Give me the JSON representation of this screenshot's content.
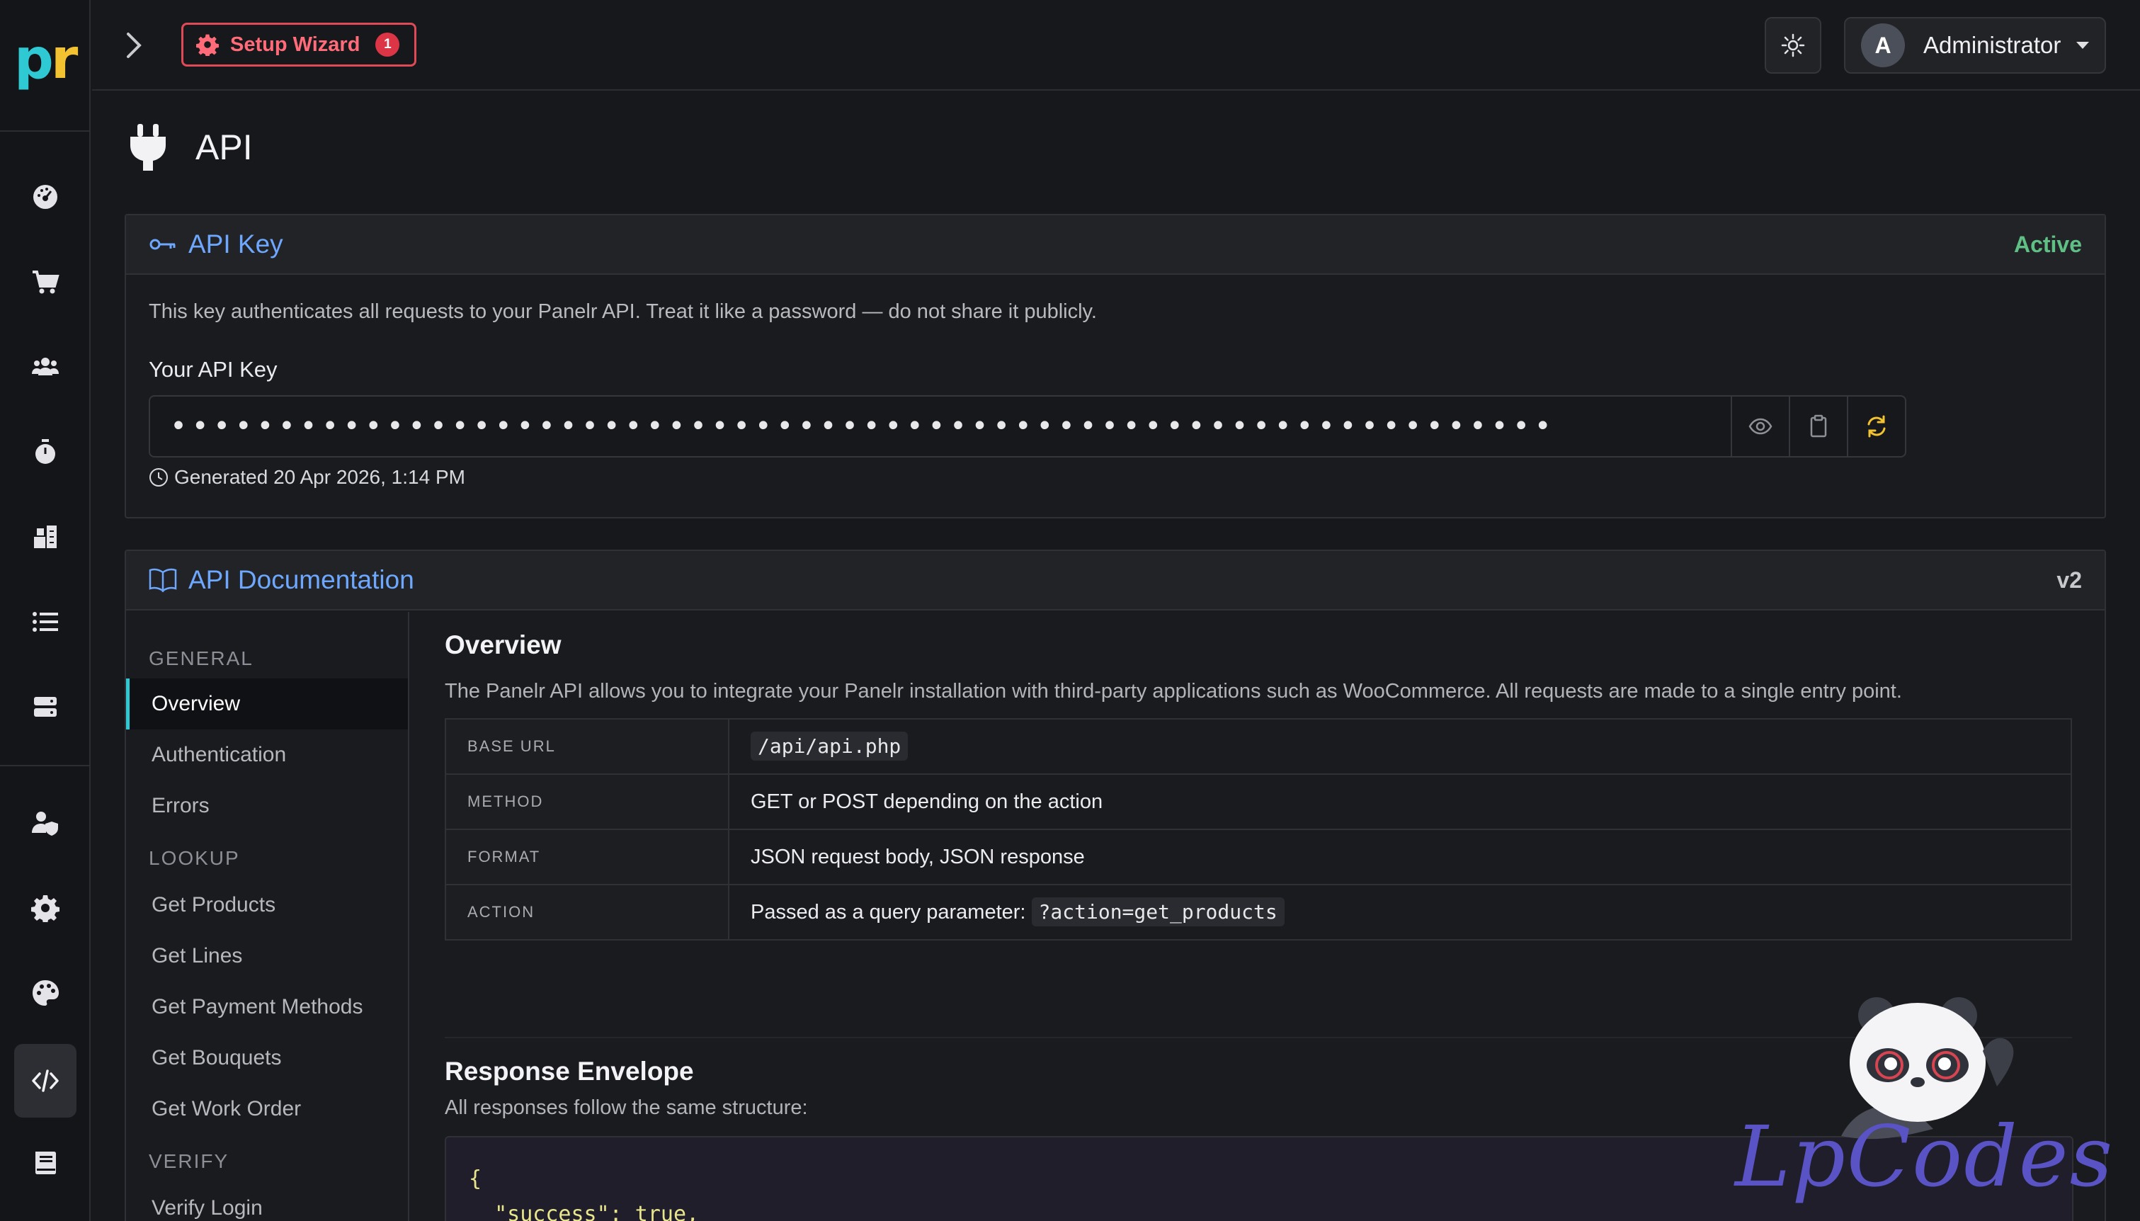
{
  "sidebar": {
    "logo": {
      "p": "p",
      "r": "r"
    },
    "items": [
      {
        "name": "dashboard",
        "icon": "gauge-icon"
      },
      {
        "name": "orders",
        "icon": "cart-icon"
      },
      {
        "name": "customers",
        "icon": "users-icon"
      },
      {
        "name": "timers",
        "icon": "stopwatch-icon"
      },
      {
        "name": "stock",
        "icon": "boxes-icon"
      },
      {
        "name": "lists",
        "icon": "list-icon"
      },
      {
        "name": "servers",
        "icon": "server-icon"
      },
      {
        "name": "user-admin",
        "icon": "user-shield-icon"
      },
      {
        "name": "settings",
        "icon": "gear-icon"
      },
      {
        "name": "theme",
        "icon": "palette-icon"
      },
      {
        "name": "api",
        "icon": "code-icon",
        "active": true
      },
      {
        "name": "docs",
        "icon": "book-icon"
      }
    ]
  },
  "topbar": {
    "setup_wizard_label": "Setup Wizard",
    "setup_wizard_badge": "1",
    "user_initial": "A",
    "user_name": "Administrator"
  },
  "page": {
    "title": "API"
  },
  "api_key": {
    "title": "API Key",
    "status": "Active",
    "description": "This key authenticates all requests to your Panelr API. Treat it like a password — do not share it publicly.",
    "label": "Your API Key",
    "masked_value": "••••••••••••••••••••••••••••••••••••••••••••••••••••••••••••••••",
    "generated": "Generated 20 Apr 2026, 1:14 PM"
  },
  "docs": {
    "title": "API Documentation",
    "version": "v2",
    "nav": {
      "general_label": "GENERAL",
      "general": [
        "Overview",
        "Authentication",
        "Errors"
      ],
      "lookup_label": "LOOKUP",
      "lookup": [
        "Get Products",
        "Get Lines",
        "Get Payment Methods",
        "Get Bouquets",
        "Get Work Order"
      ],
      "verify_label": "VERIFY",
      "verify": [
        "Verify Login"
      ]
    },
    "overview": {
      "heading": "Overview",
      "text": "The Panelr API allows you to integrate your Panelr installation with third-party applications such as WooCommerce. All requests are made to a single entry point.",
      "rows": [
        {
          "key": "BASE URL",
          "value": "/api/api.php"
        },
        {
          "key": "METHOD",
          "value": "GET or POST depending on the action"
        },
        {
          "key": "FORMAT",
          "value": "JSON request body, JSON response"
        },
        {
          "key": "ACTION",
          "prefix": "Passed as a query parameter:",
          "code": "?action=get_products"
        }
      ]
    },
    "envelope": {
      "heading": "Response Envelope",
      "text": "All responses follow the same structure:",
      "code_line1": "{",
      "code_line2": "  \"success\": true,"
    }
  },
  "watermark": {
    "text": "LpCodes"
  },
  "colors": {
    "accent": "#6ea8fe",
    "active": "#5fbf85",
    "danger": "#e04a57",
    "brand_cyan": "#2ec9d3",
    "brand_yellow": "#f2c230"
  }
}
